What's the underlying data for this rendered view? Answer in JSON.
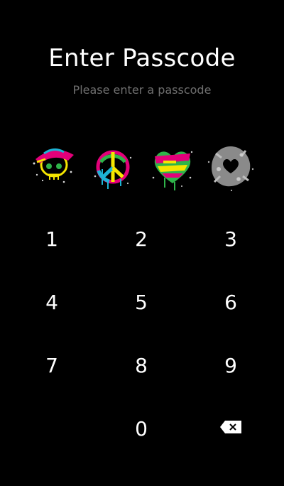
{
  "header": {
    "title": "Enter Passcode",
    "subtitle": "Please enter a passcode"
  },
  "slots": [
    {
      "icon": "skull-with-hat-graffiti-icon"
    },
    {
      "icon": "peace-sign-graffiti-icon"
    },
    {
      "icon": "heart-graffiti-icon"
    },
    {
      "icon": "gray-heart-splat-icon"
    }
  ],
  "keypad": {
    "keys": [
      "1",
      "2",
      "3",
      "4",
      "5",
      "6",
      "7",
      "8",
      "9",
      "0"
    ],
    "backspace_icon": "backspace-icon"
  },
  "colors": {
    "background": "#000000",
    "text": "#ffffff",
    "subtitle": "#6f6f6f",
    "pink": "#e3007a",
    "yellow": "#f5e600",
    "green": "#2fb44a",
    "cyan": "#1db4d6"
  }
}
